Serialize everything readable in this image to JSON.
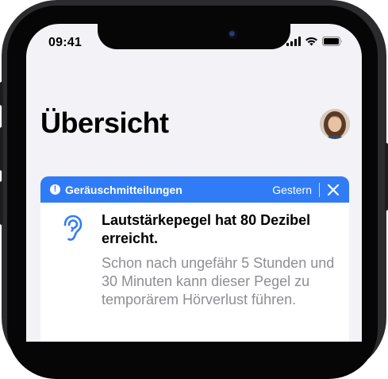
{
  "status_bar": {
    "time": "09:41"
  },
  "page": {
    "title": "Übersicht"
  },
  "notification": {
    "category": "Geräuschmitteilungen",
    "date": "Gestern",
    "headline": "Lautstärkepegel hat 80 Dezibel erreicht.",
    "body": "Schon nach ungefähr 5 Stunden und 30 Minuten kann dieser Pegel zu temporärem Hörverlust führen.",
    "alert_glyph": "!",
    "icons": [
      "alert-icon",
      "close-icon",
      "ear-icon"
    ]
  },
  "colors": {
    "accent": "#2f7cf6",
    "background": "#f2f2f7",
    "secondary_text": "#8e8e93"
  }
}
